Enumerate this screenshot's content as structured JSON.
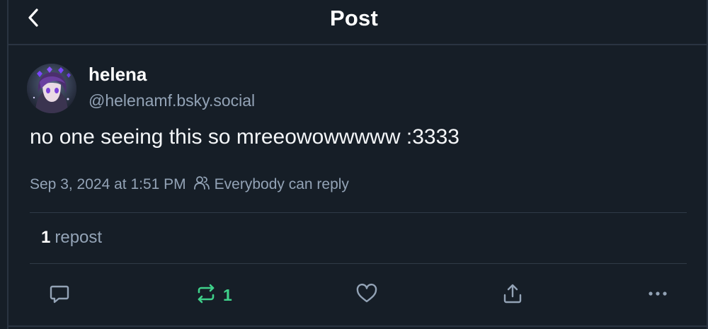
{
  "header": {
    "title": "Post",
    "back_icon": "chevron-left-icon"
  },
  "post": {
    "author": {
      "display_name": "helena",
      "handle": "@helenamf.bsky.social",
      "avatar": "avatar-image"
    },
    "text": "no one seeing this so mreeowowwwww :3333",
    "timestamp": "Sep 3, 2024 at 1:51 PM",
    "reply_setting": "Everybody can reply",
    "reply_setting_icon": "people-icon",
    "stats": {
      "reposts_count": "1",
      "reposts_label": "repost"
    }
  },
  "actions": {
    "reply_icon": "comment-icon",
    "repost_icon": "repost-icon",
    "repost_count": "1",
    "like_icon": "heart-icon",
    "share_icon": "share-icon",
    "more_icon": "ellipsis-icon"
  },
  "colors": {
    "background": "#161e27",
    "text_primary": "#ffffff",
    "text_secondary": "#93a3b6",
    "repost_active": "#3fd18a",
    "divider": "#2f3a47"
  }
}
